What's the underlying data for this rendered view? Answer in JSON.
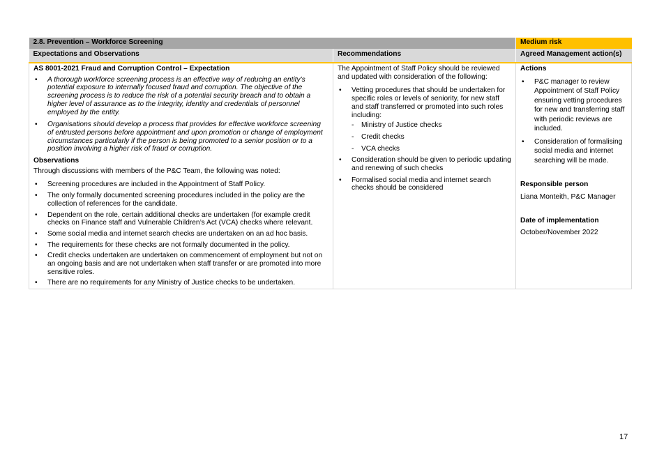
{
  "section_title": "2.8. Prevention – Workforce Screening",
  "risk_label": "Medium risk",
  "columns": {
    "col1": "Expectations and Observations",
    "col2": "Recommendations",
    "col3": "Agreed Management action(s)"
  },
  "expectations": {
    "heading": "AS 8001-2021 Fraud and Corruption Control – Expectation",
    "items": [
      "A thorough workforce screening process is an effective way of reducing an entity’s potential exposure to internally focused fraud and corruption. The objective of the screening process is to reduce the risk of a potential security breach and to obtain a higher level of assurance as to the integrity, identity and credentials of personnel employed by the entity.",
      "Organisations should develop a process that provides for effective workforce screening of entrusted persons before appointment and upon promotion or change of employment circumstances particularly if the person is being promoted to a senior position or to a position involving a higher risk of fraud or corruption."
    ]
  },
  "observations": {
    "heading": "Observations",
    "intro": "Through discussions with members of the P&C Team, the following was noted:",
    "items": [
      "Screening procedures are included in the Appointment of Staff Policy.",
      "The only formally documented screening procedures included in the policy are the collection of references for the candidate.",
      "Dependent on the role, certain additional checks are undertaken (for example credit checks on Finance staff and Vulnerable Children’s Act (VCA) checks where relevant.",
      "Some social media and internet search checks are undertaken on an ad hoc basis.",
      "The requirements for these checks are not formally documented in the policy.",
      "Credit checks undertaken are undertaken on commencement of employment but not on an ongoing basis and are not undertaken when staff transfer or are promoted into more sensitive roles.",
      "There are no requirements for any Ministry of Justice checks to be undertaken."
    ]
  },
  "recommendations": {
    "intro": "The Appointment of Staff Policy should be reviewed and updated with consideration of the following:",
    "item1": "Vetting procedures that should be undertaken for specific roles or levels of seniority, for new staff and staff transferred or promoted into such roles including:",
    "subitems": [
      "Ministry of Justice checks",
      "Credit checks",
      "VCA checks"
    ],
    "item2": "Consideration should be given to periodic updating and renewing of such checks",
    "item3": "Formalised social media and internet search checks should be considered"
  },
  "management": {
    "actions_heading": "Actions",
    "actions": [
      "P&C manager to review Appointment of Staff Policy ensuring vetting procedures for new and transferring staff with periodic reviews are included.",
      "Consideration of formalising social media and internet searching will be made."
    ],
    "responsible_heading": "Responsible person",
    "responsible_value": "Liana Monteith, P&C Manager",
    "date_heading": "Date of implementation",
    "date_value": "October/November 2022"
  },
  "page_number": "17"
}
